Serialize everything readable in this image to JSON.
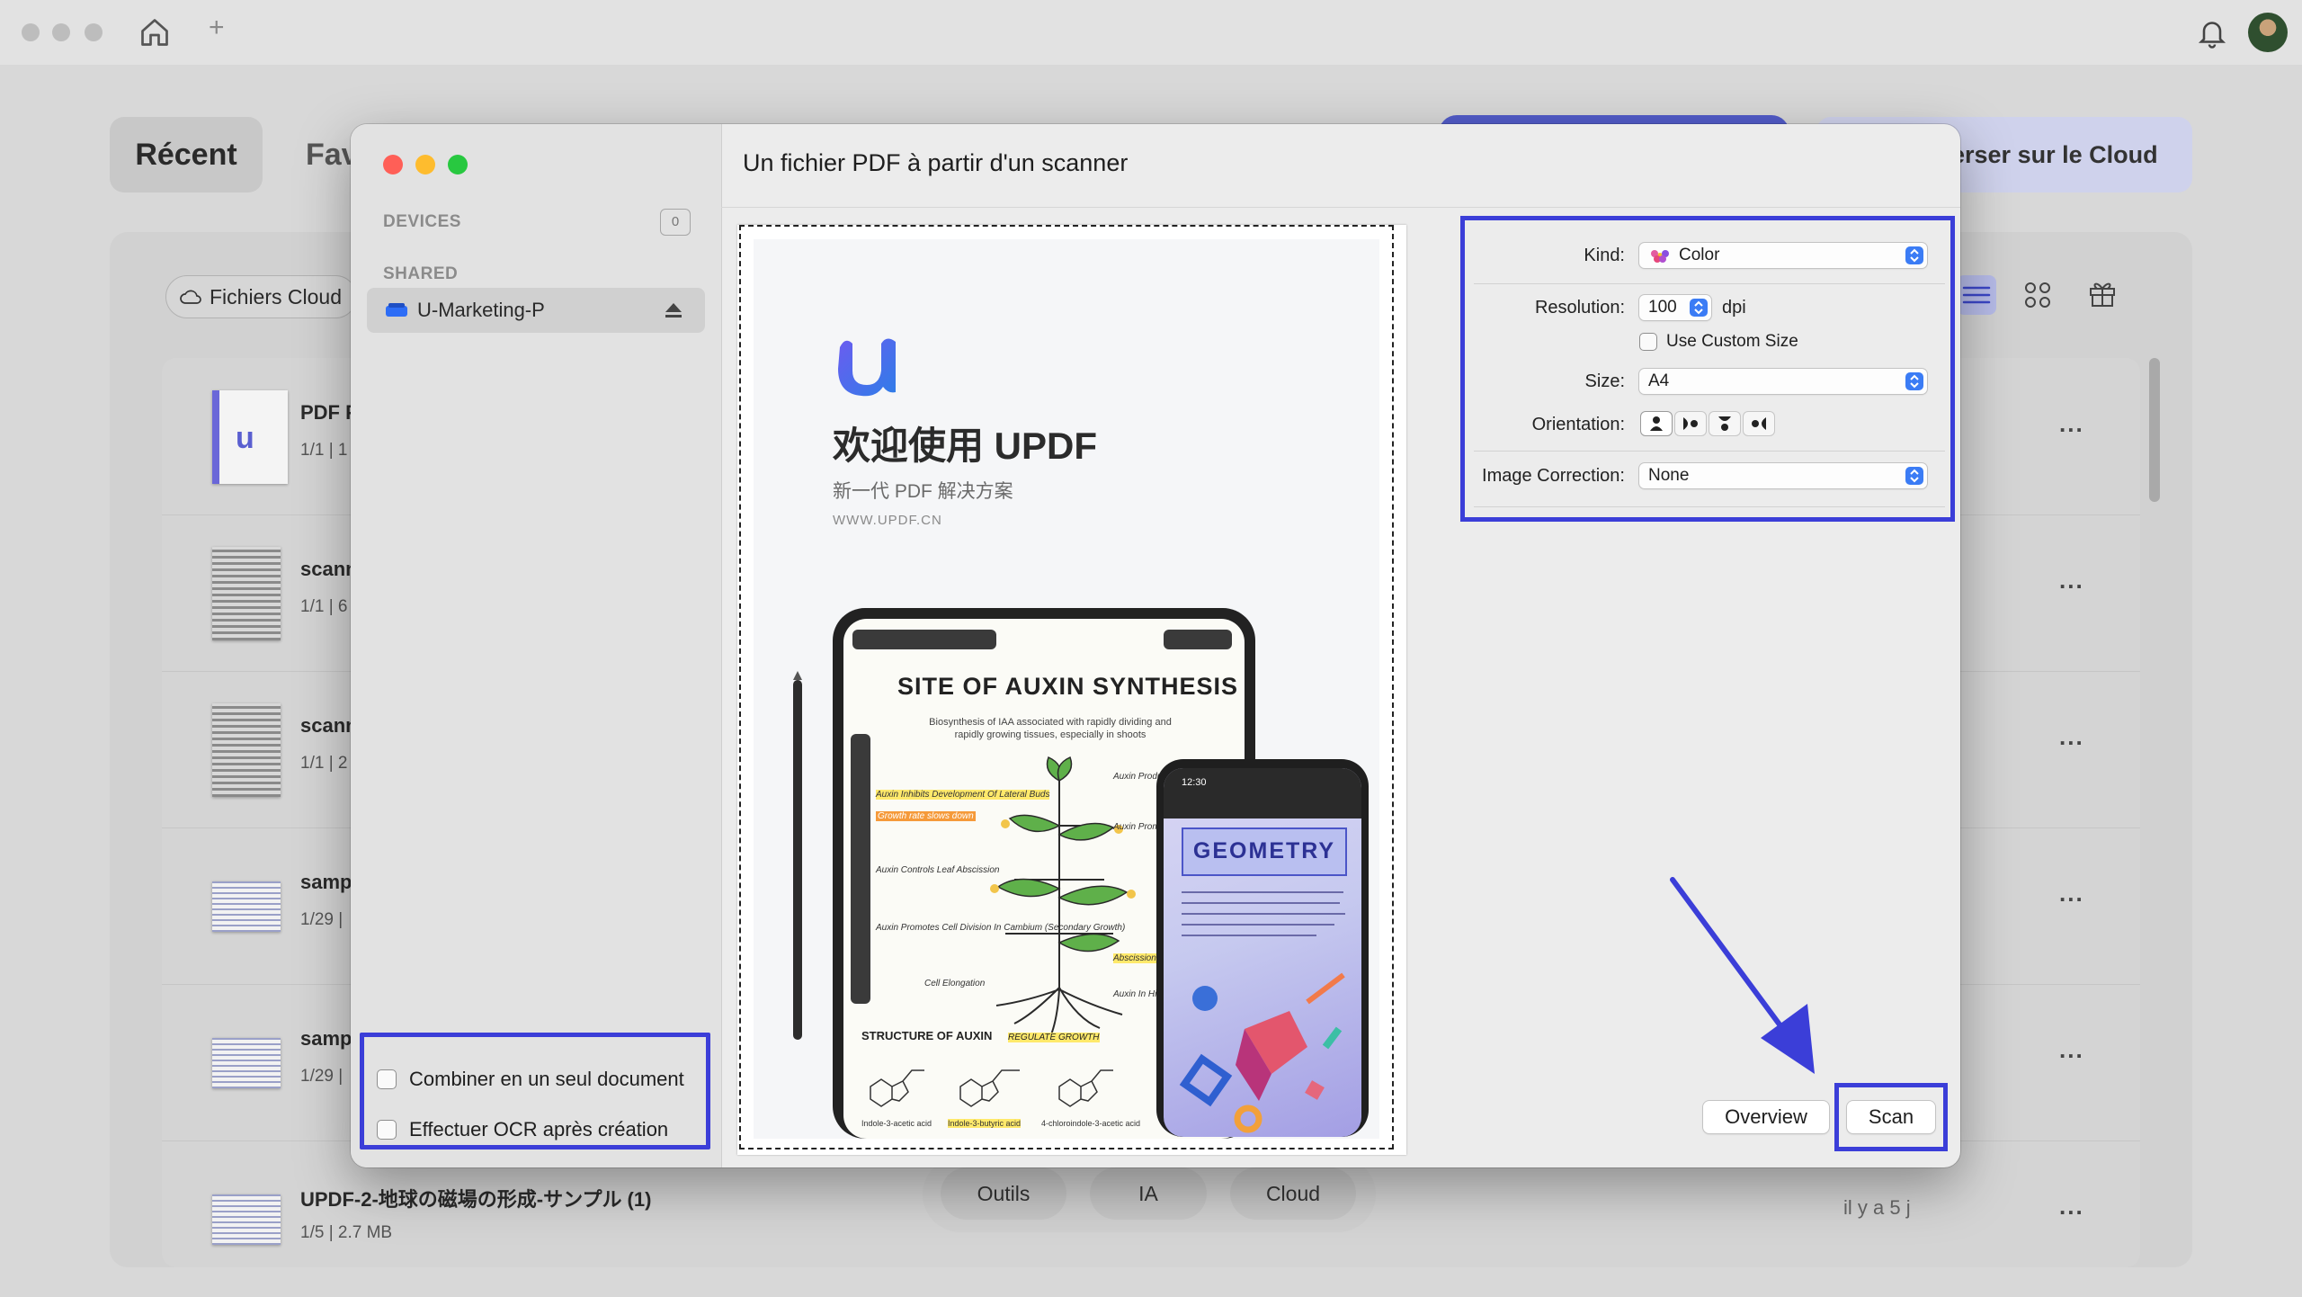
{
  "background": {
    "tabs": {
      "recent": "Récent",
      "favorites": "Fav"
    },
    "cloud_button": "erser sur le Cloud",
    "cloud_files": "Fichiers Cloud",
    "files": [
      {
        "name": "PDF F",
        "meta": "1/1 | 1"
      },
      {
        "name": "scann",
        "meta": "1/1 | 6"
      },
      {
        "name": "scann",
        "meta": "1/1 | 2"
      },
      {
        "name": "samp",
        "meta": "1/29 |"
      },
      {
        "name": "samp",
        "meta": "1/29 |"
      },
      {
        "name": "UPDF-2-地球の磁場の形成-サンプル (1)",
        "meta": "1/5 | 2.7 MB",
        "date": "il y a 5 j"
      }
    ],
    "more_label": "...",
    "bottom_bar": {
      "tools": "Outils",
      "ai": "IA",
      "cloud": "Cloud"
    }
  },
  "modal": {
    "title": "Un fichier PDF à partir d'un scanner",
    "sidebar": {
      "devices_heading": "DEVICES",
      "devices_count": "0",
      "shared_heading": "SHARED",
      "shared_device": "U-Marketing-P"
    },
    "options": {
      "combine": "Combiner en un seul document",
      "ocr": "Effectuer OCR après création"
    },
    "preview": {
      "welcome_title": "欢迎使用 UPDF",
      "welcome_sub": "新一代 PDF 解决方案",
      "welcome_url": "WWW.UPDF.CN",
      "tablet_heading": "SITE OF AUXIN SYNTHESIS",
      "tablet_desc": "Biosynthesis of IAA associated with rapidly dividing and rapidly growing tissues, especially in shoots",
      "notes": {
        "n1": "Auxin Inhibits Development Of Lateral Buds",
        "n2": "Growth rate slows down",
        "n3": "Auxin Controls Leaf Abscission",
        "n4": "Auxin Promotes Cell Division In Cambium (Secondary Growth)",
        "n5": "Auxin Produced at Apical Meristem",
        "n6": "Auxin Promotes Cell (Stems Roots Ce",
        "n7": "Abscission Zone",
        "n8": "Auxin In High Inhibits Cell Roots",
        "n9": "Cell Elongation"
      },
      "structure_title": "STRUCTURE OF AUXIN",
      "regulate_growth": "REGULATE GROWTH",
      "molecules": [
        "Indole-3-acetic acid",
        "Indole-3-butyric acid",
        "4-chloroindole-3-acetic acid"
      ],
      "phone_time": "12:30",
      "phone_heading": "GEOMETRY"
    },
    "settings": {
      "kind_label": "Kind:",
      "kind_value": "Color",
      "resolution_label": "Resolution:",
      "resolution_value": "100",
      "resolution_unit": "dpi",
      "custom_size_label": "Use Custom Size",
      "size_label": "Size:",
      "size_value": "A4",
      "orientation_label": "Orientation:",
      "image_correction_label": "Image Correction:",
      "image_correction_value": "None"
    },
    "buttons": {
      "overview": "Overview",
      "scan": "Scan"
    }
  },
  "colors": {
    "highlight": "#3b3ed8",
    "popup_accent": "#3b7cf5"
  }
}
